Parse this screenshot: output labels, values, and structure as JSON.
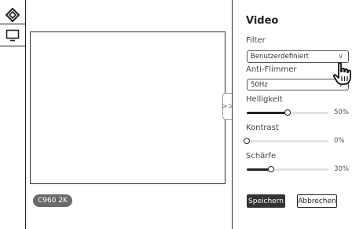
{
  "panel": {
    "title": "Video",
    "filter": {
      "label": "Filter",
      "value": "Benutzerdefiniert"
    },
    "antiflicker": {
      "label": "Anti-Flimmer",
      "value": "50Hz"
    },
    "brightness": {
      "label": "Helligkeit",
      "value_text": "50%",
      "value": 50
    },
    "contrast": {
      "label": "Kontrast",
      "value_text": "0%",
      "value": 0
    },
    "sharpness": {
      "label": "Schärfe",
      "value_text": "30%",
      "value": 30
    },
    "save_label": "Speichern",
    "cancel_label": "Abbrechen"
  },
  "preview": {
    "model": "C960 2K"
  },
  "icons": {
    "logo": "diamond-logo-icon",
    "monitor": "monitor-icon",
    "collapse": "chevron-right-icon",
    "cursor": "hand-pointer-icon"
  },
  "colors": {
    "accent": "#333333",
    "badge": "#6a6a6a"
  }
}
